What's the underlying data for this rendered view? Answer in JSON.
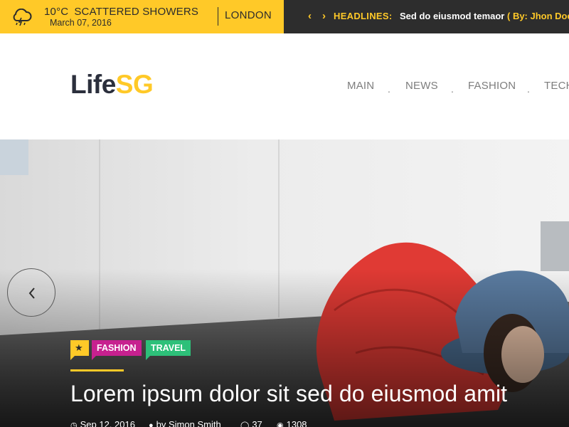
{
  "weather": {
    "icon": "cloud-rain-lightning-icon",
    "temperature": "10°C",
    "condition": "SCATTERED SHOWERS",
    "date": "March 07, 2016",
    "city": "LONDON"
  },
  "ticker": {
    "prev_icon": "chevron-left-icon",
    "next_icon": "chevron-right-icon",
    "label": "HEADLINES:",
    "headline": "Sed do eiusmod temaor",
    "byline": "( By: Jhon Doe )"
  },
  "header": {
    "logo_part1": "Life",
    "logo_part2": "SG",
    "nav": [
      {
        "label": "MAIN"
      },
      {
        "label": "NEWS"
      },
      {
        "label": "FASHION"
      },
      {
        "label": "TECH"
      }
    ]
  },
  "hero": {
    "prev_icon": "chevron-left-icon",
    "featured_icon": "star-icon",
    "tags": [
      {
        "label": "FASHION",
        "color": "#c7218f"
      },
      {
        "label": "TRAVEL",
        "color": "#2dc079"
      }
    ],
    "title": "Lorem ipsum dolor sit sed do eiusmod amit",
    "meta": {
      "date": "Sep 12, 2016",
      "author": "by Simon Smith",
      "comments": "37",
      "views": "1308"
    }
  },
  "colors": {
    "accent": "#ffc928",
    "dark": "#2d2d2d",
    "logo_dark": "#2b2f3c"
  }
}
